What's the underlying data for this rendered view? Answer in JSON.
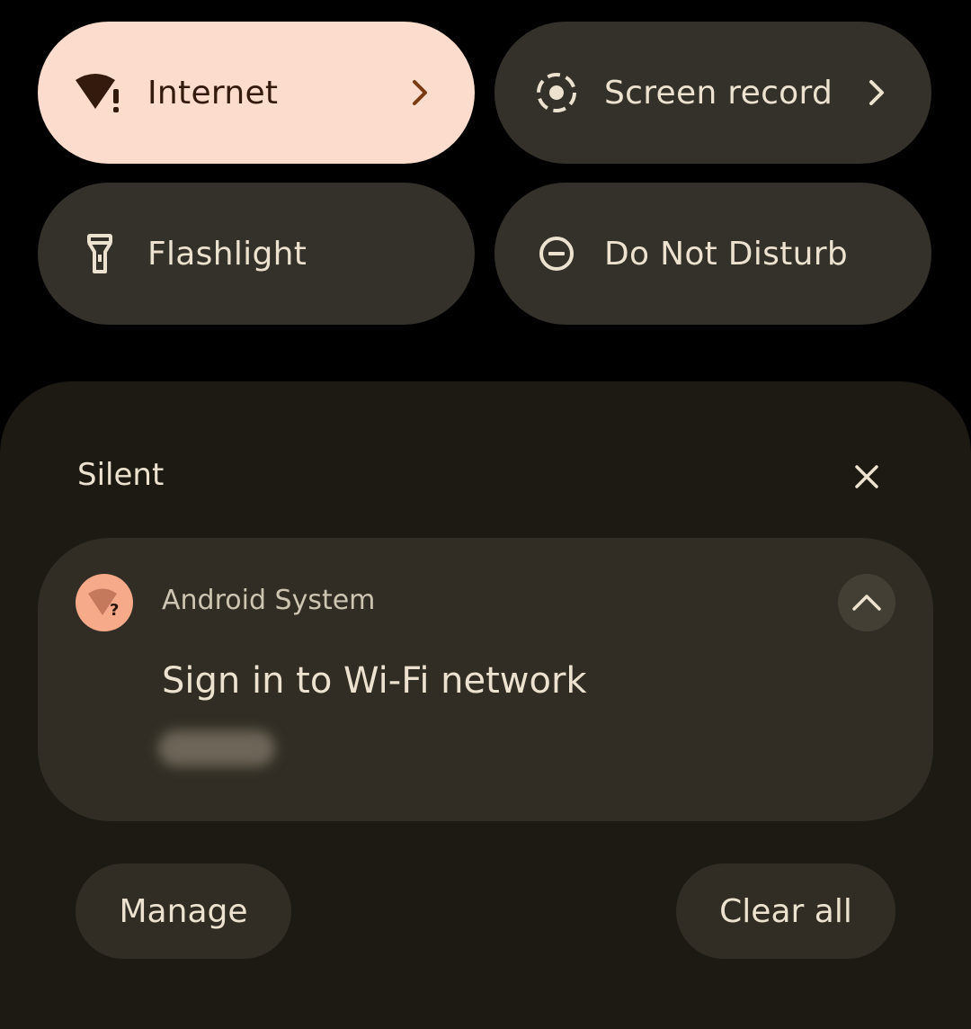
{
  "quick_tiles": [
    {
      "label": "Internet",
      "icon": "wifi-alert-icon",
      "active": true,
      "has_chevron": true
    },
    {
      "label": "Screen record",
      "icon": "screen-record-icon",
      "active": false,
      "has_chevron": true
    },
    {
      "label": "Flashlight",
      "icon": "flashlight-icon",
      "active": false,
      "has_chevron": false
    },
    {
      "label": "Do Not Disturb",
      "icon": "do-not-disturb-icon",
      "active": false,
      "has_chevron": false
    }
  ],
  "notifications": {
    "section_title": "Silent",
    "close_icon": "close-icon",
    "items": [
      {
        "app_name": "Android System",
        "app_icon": "wifi-question-icon",
        "title": "Sign in to Wi-Fi network",
        "expand_icon": "chevron-up-icon"
      }
    ]
  },
  "actions": {
    "manage_label": "Manage",
    "clear_all_label": "Clear all"
  },
  "colors": {
    "background": "#000000",
    "tile_inactive": "#34302a",
    "tile_active": "#fcdccc",
    "shade": "#1c1a12",
    "card": "#312d24",
    "accent_icon": "#f7aa8a",
    "text_primary": "#ece2cf"
  }
}
